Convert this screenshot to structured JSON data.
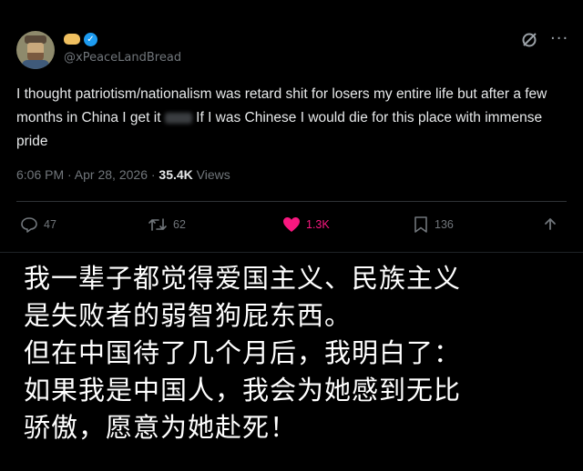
{
  "tweet": {
    "handle": "@xPeaceLandBread",
    "body_part1": "I thought patriotism/nationalism was retard shit for losers my entire life but after a few months in China I get it",
    "body_part2": " If I was Chinese I would die for this place with immense pride",
    "timestamp": "6:06 PM · Apr 28, 2026 · ",
    "views_count": "35.4K",
    "views_label": " Views",
    "actions": {
      "replies": "47",
      "reposts": "62",
      "likes": "1.3K",
      "bookmarks": "136"
    },
    "icons": {
      "badge": "clapping-hand-icon",
      "verified": "verified-badge-icon",
      "grok": "grok-icon",
      "more": "more-icon",
      "reply": "reply-icon",
      "repost": "repost-icon",
      "like": "heart-icon",
      "bookmark": "bookmark-icon",
      "share": "share-icon"
    },
    "colors": {
      "verified": "#1d9bf0",
      "like": "#f91880",
      "muted": "#71767b",
      "text": "#e7e9ea"
    }
  },
  "caption": {
    "line1": "我一辈子都觉得爱国主义、民族主义",
    "line2": "是失败者的弱智狗屁东西。",
    "line3": "但在中国待了几个月后，我明白了：",
    "line4": "如果我是中国人，我会为她感到无比",
    "line5": "骄傲，愿意为她赴死！"
  }
}
